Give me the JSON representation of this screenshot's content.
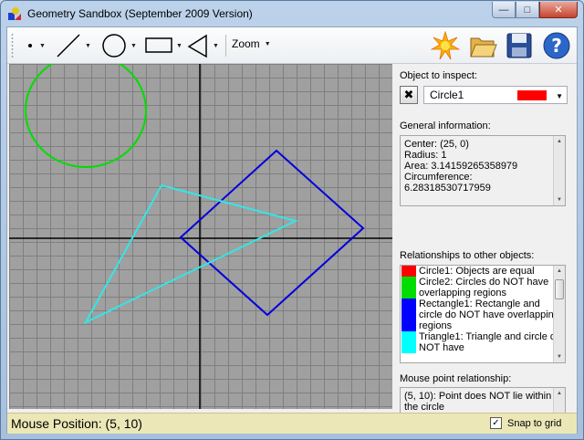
{
  "window": {
    "title": "Geometry Sandbox (September 2009 Version)"
  },
  "toolbar": {
    "zoom_label": "Zoom"
  },
  "inspect": {
    "label": "Object to inspect:",
    "selected": "Circle1",
    "selected_color": "#ff0000"
  },
  "general": {
    "label": "General information:",
    "lines": [
      "Center: (25, 0)",
      "Radius: 1",
      "Area: 3.14159265358979",
      "Circumference:",
      "6.28318530717959"
    ]
  },
  "relationships": {
    "label": "Relationships to other objects:",
    "items": [
      {
        "text": "Circle1: Objects are equal",
        "color": "#ff0000"
      },
      {
        "text": "Circle2: Circles do NOT have overlapping regions",
        "color": "#00dd00"
      },
      {
        "text": "Rectangle1: Rectangle and circle do NOT have overlapping regions",
        "color": "#0000ff"
      },
      {
        "text": "Triangle1: Triangle and circle do NOT have",
        "color": "#00ffff"
      }
    ]
  },
  "mouse_rel": {
    "label": "Mouse point relationship:",
    "text": "(5, 10): Point does NOT lie within the circle"
  },
  "status": {
    "mouse_position": "Mouse Position: (5, 10)",
    "snap_label": "Snap to grid",
    "snap_checked": true
  },
  "colors": {
    "circle": "#00dd00",
    "rectangle": "#0000dd",
    "triangle": "#33e6e6",
    "axes": "#000000"
  }
}
